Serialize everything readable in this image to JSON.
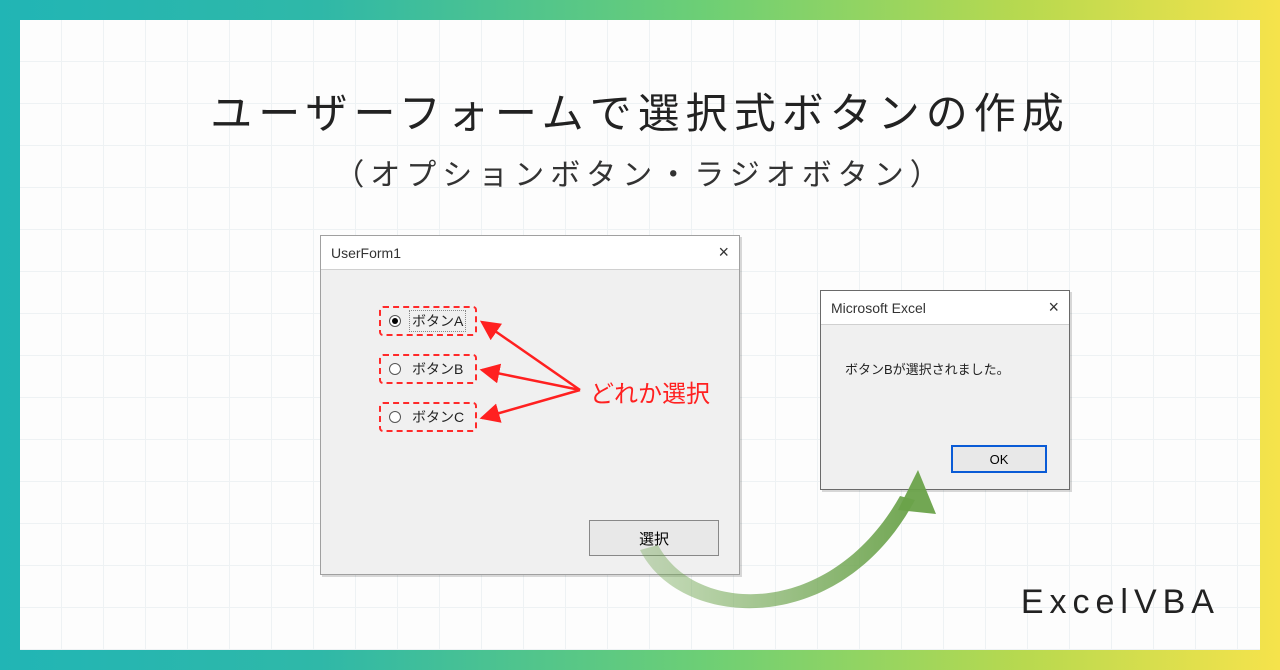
{
  "title": {
    "pre": "ユーザーフォームで",
    "hl": "選択",
    "post": "式ボタンの作成"
  },
  "subtitle": "（オプションボタン・ラジオボタン）",
  "userform": {
    "title": "UserForm1",
    "close": "×",
    "options": {
      "a": "ボタンA",
      "b": "ボタンB",
      "c": "ボタンC"
    },
    "annotation": "どれか選択",
    "select_button": "選択"
  },
  "msgbox": {
    "title": "Microsoft Excel",
    "close": "×",
    "message": "ボタンBが選択されました。",
    "ok": "OK"
  },
  "brand": "ExcelVBA"
}
